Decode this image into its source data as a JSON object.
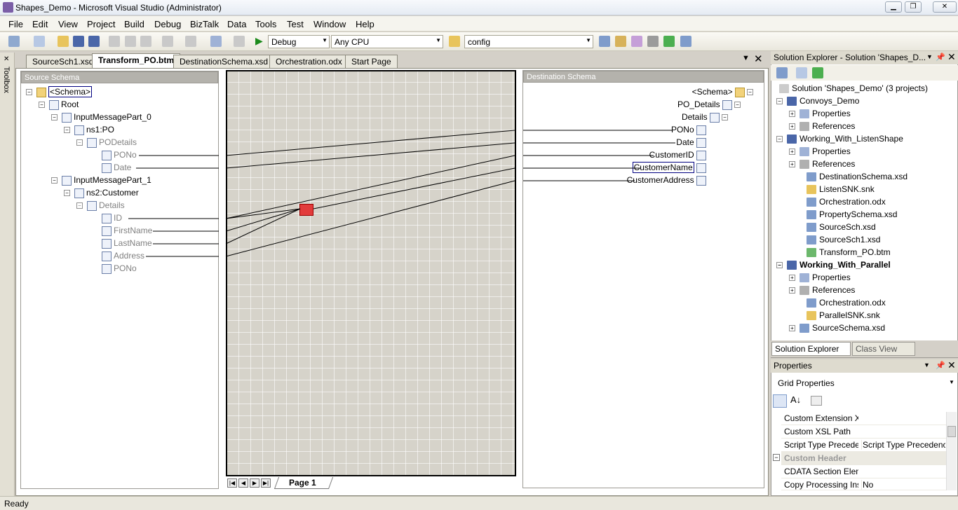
{
  "window": {
    "title": "Shapes_Demo - Microsoft Visual Studio (Administrator)"
  },
  "menu": [
    "File",
    "Edit",
    "View",
    "Project",
    "Build",
    "Debug",
    "BizTalk",
    "Data",
    "Tools",
    "Test",
    "Window",
    "Help"
  ],
  "toolbar": {
    "config_combo": "Debug",
    "platform_combo": "Any CPU",
    "find_combo": "config"
  },
  "toolbox": {
    "label": "Toolbox"
  },
  "doc_tabs": [
    "SourceSch1.xsd",
    "Transform_PO.btm",
    "DestinationSchema.xsd",
    "Orchestration.odx",
    "Start Page"
  ],
  "active_tab": "Transform_PO.btm",
  "source_schema": {
    "title": "Source Schema",
    "nodes": [
      "<Schema>",
      "Root",
      "InputMessagePart_0",
      "ns1:PO",
      "PODetails",
      "PONo",
      "Date",
      "InputMessagePart_1",
      "ns2:Customer",
      "Details",
      "ID",
      "FirstName",
      "LastName",
      "Address",
      "PONo"
    ]
  },
  "destination_schema": {
    "title": "Destination Schema",
    "nodes": [
      "<Schema>",
      "PO_Details",
      "Details",
      "PONo",
      "Date",
      "CustomerID",
      "CustomerName",
      "CustomerAddress"
    ]
  },
  "grid": {
    "page_label": "Page 1"
  },
  "solution_explorer": {
    "title": "Solution Explorer - Solution 'Shapes_D...",
    "items": [
      "Solution 'Shapes_Demo' (3 projects)",
      "Convoys_Demo",
      "Properties",
      "References",
      "Working_With_ListenShape",
      "Properties",
      "References",
      "DestinationSchema.xsd",
      "ListenSNK.snk",
      "Orchestration.odx",
      "PropertySchema.xsd",
      "SourceSch.xsd",
      "SourceSch1.xsd",
      "Transform_PO.btm",
      "Working_With_Parallel",
      "Properties",
      "References",
      "Orchestration.odx",
      "ParallelSNK.snk",
      "SourceSchema.xsd"
    ],
    "tabs": [
      "Solution Explorer",
      "Class View"
    ]
  },
  "properties": {
    "title": "Properties",
    "object": "Grid Properties",
    "rows": [
      {
        "name": "Custom Extension X",
        "value": ""
      },
      {
        "name": "Custom XSL Path",
        "value": ""
      },
      {
        "name": "Script Type Preceden",
        "value": "Script Type Precedence"
      },
      {
        "name": "Custom Header",
        "value": ""
      },
      {
        "name": "CDATA Section Elem",
        "value": ""
      },
      {
        "name": "Copy Processing Ins",
        "value": "No"
      }
    ]
  },
  "status": {
    "text": "Ready"
  }
}
